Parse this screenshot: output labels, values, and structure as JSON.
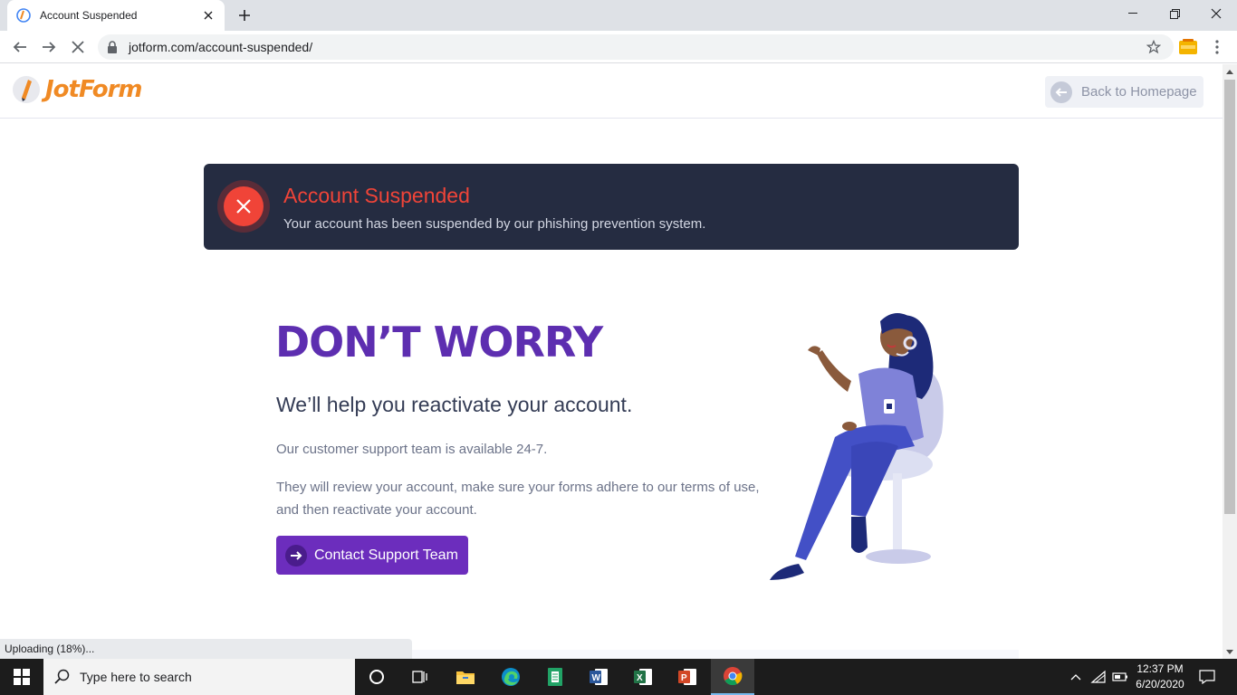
{
  "browser": {
    "tab_title": "Account Suspended",
    "url": "jotform.com/account-suspended/"
  },
  "page": {
    "logo_text": "JotForm",
    "back_button": "Back to Homepage",
    "alert": {
      "title": "Account Suspended",
      "message": "Your account has been suspended by our phishing prevention system."
    },
    "headline": "DON’T WORRY",
    "subhead": "We’ll help you reactivate your account.",
    "para1": "Our customer support team is available 24-7.",
    "para2": "They will review your account, make sure your forms adhere to our terms of use, and then reactivate your account.",
    "cta": "Contact Support Team",
    "status": "Uploading (18%)..."
  },
  "taskbar": {
    "search_placeholder": "Type here to search",
    "time": "12:37 PM",
    "date": "6/20/2020",
    "apps": [
      "task-view",
      "file-explorer",
      "edge",
      "notepad",
      "word",
      "excel",
      "powerpoint",
      "chrome"
    ]
  },
  "colors": {
    "brand_orange": "#f08a24",
    "headline_purple": "#5d2eb0",
    "cta_purple": "#6c2dbd",
    "alert_bg": "#252c41",
    "alert_red": "#f04438"
  }
}
